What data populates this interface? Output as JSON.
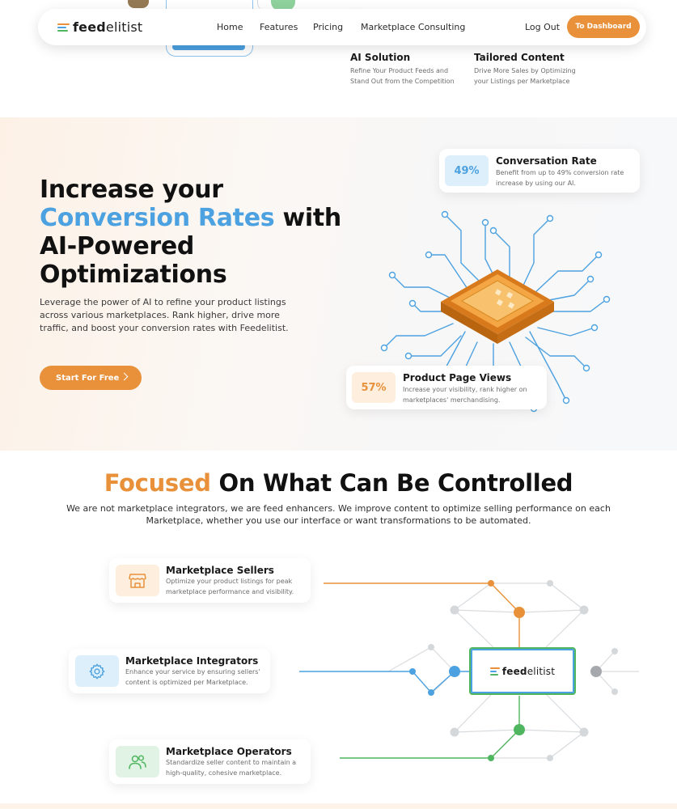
{
  "brand": {
    "name_bold": "feed",
    "name_regular": "elitist"
  },
  "nav": {
    "links": [
      "Home",
      "Features",
      "Pricing",
      "Marketplace Consulting"
    ],
    "logout": "Log Out",
    "dashboard_button": "To Dashboard"
  },
  "features_top": [
    {
      "title": "AI Solution",
      "desc": "Refine Your Product Feeds and Stand Out from the Competition"
    },
    {
      "title": "Tailored Content",
      "desc": "Drive More Sales by Optimizing your Listings per Marketplace"
    }
  ],
  "hero": {
    "title_line1": "Increase your",
    "title_highlight": "Conversion Rates",
    "title_line2_rest": " with",
    "title_line3": "AI-Powered",
    "title_line4": "Optimizations",
    "description": "Leverage the power of AI to refine your product listings across various marketplaces. Rank higher, drive more traffic, and boost your conversion rates with Feedelitist.",
    "cta": "Start For Free"
  },
  "stats": [
    {
      "value": "49%",
      "title": "Conversation Rate",
      "desc": "Benefit from up to 49% conversion rate increase by using our AI."
    },
    {
      "value": "57%",
      "title": "Product Page Views",
      "desc": "Increase your visibility, rank higher on marketplaces' merchandising."
    }
  ],
  "focused": {
    "title_highlight": "Focused",
    "title_rest": " On What Can Be Controlled",
    "description": "We are not marketplace integrators, we are feed enhancers. We improve content to optimize selling performance on each Marketplace, whether you use our interface or want transformations to be automated."
  },
  "roles": [
    {
      "title": "Marketplace Sellers",
      "desc": "Optimize your product listings for peak marketplace performance and visibility.",
      "icon": "storefront-icon"
    },
    {
      "title": "Marketplace Integrators",
      "desc": "Enhance your service by ensuring sellers' content is optimized per Marketplace.",
      "icon": "gear-icon"
    },
    {
      "title": "Marketplace Operators",
      "desc": "Standardize seller content to maintain a high-quality, cohesive marketplace.",
      "icon": "users-icon"
    }
  ],
  "colors": {
    "orange": "#e8913a",
    "blue": "#4ca1e0",
    "green": "#4fb65f",
    "gray": "#a5a8ad"
  }
}
